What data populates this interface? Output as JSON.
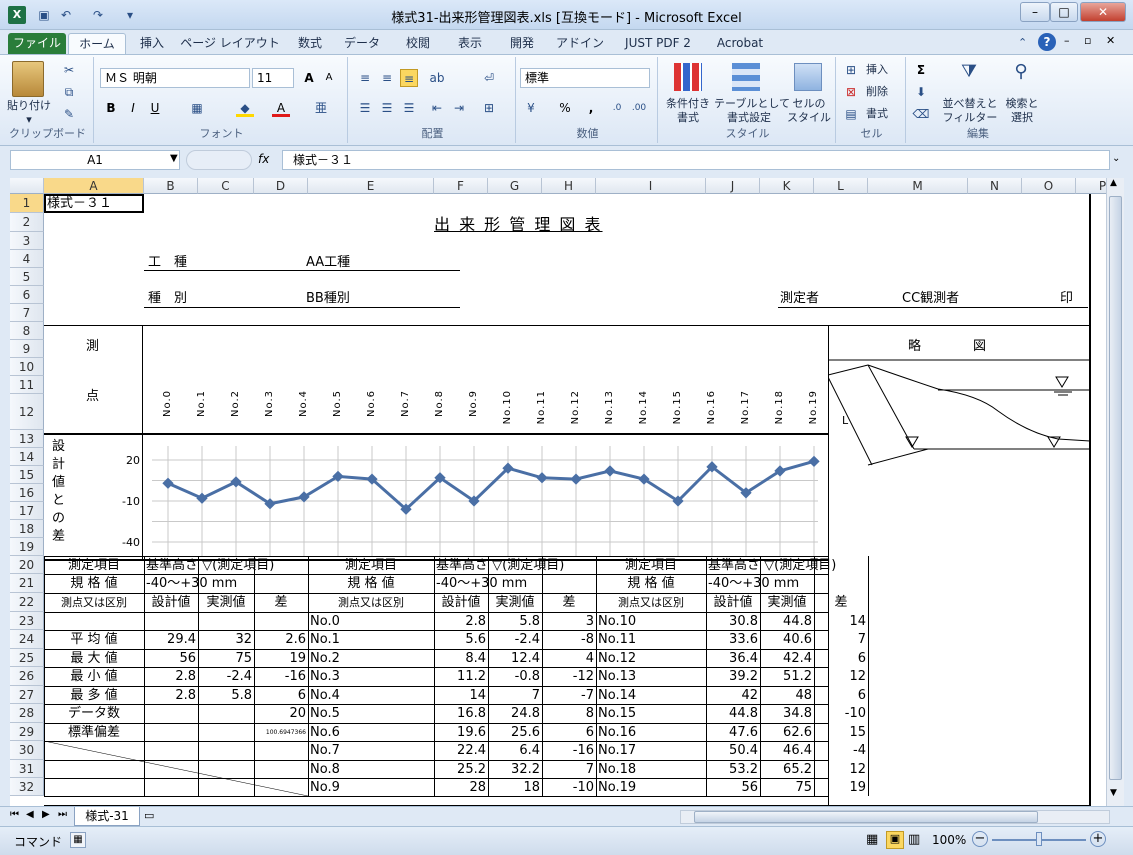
{
  "window": {
    "title": "様式31-出来形管理図表.xls  [互換モード] - Microsoft Excel"
  },
  "ribbon_tabs": [
    "ファイル",
    "ホーム",
    "挿入",
    "ページ レイアウト",
    "数式",
    "データ",
    "校閲",
    "表示",
    "開発",
    "アドイン",
    "JUST PDF 2",
    "Acrobat"
  ],
  "clipboard": {
    "paste": "貼り付け",
    "group": "クリップボード"
  },
  "font": {
    "name": "ＭＳ 明朝",
    "size": "11",
    "bold": "B",
    "italic": "I",
    "underline": "U",
    "group": "フォント",
    "grow": "A",
    "shrink": "A",
    "color_a": "A"
  },
  "alignment": {
    "group": "配置"
  },
  "number": {
    "format": "標準",
    "percent": "%",
    "comma": ",",
    "group": "数値"
  },
  "styles": {
    "conditional": "条件付き\n書式",
    "table": "テーブルとして\n書式設定",
    "cell": "セルの\nスタイル",
    "group": "スタイル"
  },
  "cells_group": {
    "insert": "挿入",
    "delete": "削除",
    "format": "書式",
    "group": "セル"
  },
  "editing": {
    "sum": "Σ",
    "sort": "並べ替えと\nフィルター",
    "find": "検索と\n選択",
    "group": "編集"
  },
  "formula_bar": {
    "name_box": "A1",
    "fx": "fx",
    "value": "様式－３１"
  },
  "columns": [
    "A",
    "B",
    "C",
    "D",
    "E",
    "F",
    "G",
    "H",
    "I",
    "J",
    "K",
    "L",
    "M",
    "N",
    "O",
    "P"
  ],
  "rows": [
    "1",
    "2",
    "3",
    "4",
    "5",
    "6",
    "7",
    "8",
    "9",
    "10",
    "11",
    "12",
    "13",
    "14",
    "15",
    "16",
    "17",
    "18",
    "19",
    "20",
    "21",
    "22",
    "23",
    "24",
    "25",
    "26",
    "27",
    "28",
    "29",
    "30",
    "31",
    "32"
  ],
  "sheet": {
    "a1": "様式－３１",
    "title": "出 来 形 管 理 図 表",
    "koushu_label": "工　種",
    "koushu_value": "AA工種",
    "shubetsu_label": "種　別",
    "shubetsu_value": "BB種別",
    "sokuteisha_label": "測定者",
    "sokuteisha_value": "CC観測者",
    "in": "印",
    "sokuten_1": "測",
    "sokuten_2": "点",
    "ryakuzu": "略　　　　図",
    "diagram_L": "L",
    "vlabel": [
      "設",
      "計",
      "値",
      "と",
      "の",
      "差"
    ],
    "points": [
      "No.0",
      "No.1",
      "No.2",
      "No.3",
      "No.4",
      "No.5",
      "No.6",
      "No.7",
      "No.8",
      "No.9",
      "No.10",
      "No.11",
      "No.12",
      "No.13",
      "No.14",
      "No.15",
      "No.16",
      "No.17",
      "No.18",
      "No.19"
    ],
    "item_label": "測定項目",
    "item_value": "基準高さ ▽(測定項目)",
    "kikaku_label": "規 格 値",
    "kikaku_value": "-40～+30 mm",
    "hdr_point": "測点又は区別",
    "hdr_design": "設計値",
    "hdr_actual": "実測値",
    "hdr_diff": "差",
    "stats": [
      {
        "label": "平 均 値",
        "design": "29.4",
        "actual": "32",
        "diff": "2.6"
      },
      {
        "label": "最 大 値",
        "design": "56",
        "actual": "75",
        "diff": "19"
      },
      {
        "label": "最 小 値",
        "design": "2.8",
        "actual": "-2.4",
        "diff": "-16"
      },
      {
        "label": "最 多 値",
        "design": "2.8",
        "actual": "5.8",
        "diff": "6"
      },
      {
        "label": "データ数",
        "design": "",
        "actual": "",
        "diff": "20"
      },
      {
        "label": "標準偏差",
        "design": "",
        "actual": "",
        "diff": "100.6947366"
      }
    ],
    "table_mid": [
      {
        "p": "No.0",
        "d": "2.8",
        "a": "5.8",
        "x": "3"
      },
      {
        "p": "No.1",
        "d": "5.6",
        "a": "-2.4",
        "x": "-8"
      },
      {
        "p": "No.2",
        "d": "8.4",
        "a": "12.4",
        "x": "4"
      },
      {
        "p": "No.3",
        "d": "11.2",
        "a": "-0.8",
        "x": "-12"
      },
      {
        "p": "No.4",
        "d": "14",
        "a": "7",
        "x": "-7"
      },
      {
        "p": "No.5",
        "d": "16.8",
        "a": "24.8",
        "x": "8"
      },
      {
        "p": "No.6",
        "d": "19.6",
        "a": "25.6",
        "x": "6"
      },
      {
        "p": "No.7",
        "d": "22.4",
        "a": "6.4",
        "x": "-16"
      },
      {
        "p": "No.8",
        "d": "25.2",
        "a": "32.2",
        "x": "7"
      },
      {
        "p": "No.9",
        "d": "28",
        "a": "18",
        "x": "-10"
      }
    ],
    "table_right": [
      {
        "p": "No.10",
        "d": "30.8",
        "a": "44.8",
        "x": "14"
      },
      {
        "p": "No.11",
        "d": "33.6",
        "a": "40.6",
        "x": "7"
      },
      {
        "p": "No.12",
        "d": "36.4",
        "a": "42.4",
        "x": "6"
      },
      {
        "p": "No.13",
        "d": "39.2",
        "a": "51.2",
        "x": "12"
      },
      {
        "p": "No.14",
        "d": "42",
        "a": "48",
        "x": "6"
      },
      {
        "p": "No.15",
        "d": "44.8",
        "a": "34.8",
        "x": "-10"
      },
      {
        "p": "No.16",
        "d": "47.6",
        "a": "62.6",
        "x": "15"
      },
      {
        "p": "No.17",
        "d": "50.4",
        "a": "46.4",
        "x": "-4"
      },
      {
        "p": "No.18",
        "d": "53.2",
        "a": "65.2",
        "x": "12"
      },
      {
        "p": "No.19",
        "d": "56",
        "a": "75",
        "x": "19"
      }
    ]
  },
  "chart_data": {
    "type": "line",
    "x": [
      "No.0",
      "No.1",
      "No.2",
      "No.3",
      "No.4",
      "No.5",
      "No.6",
      "No.7",
      "No.8",
      "No.9",
      "No.10",
      "No.11",
      "No.12",
      "No.13",
      "No.14",
      "No.15",
      "No.16",
      "No.17",
      "No.18",
      "No.19"
    ],
    "series": [
      {
        "values": [
          3,
          -8,
          4,
          -12,
          -7,
          8,
          6,
          -16,
          7,
          -10,
          14,
          7,
          6,
          12,
          6,
          -10,
          15,
          -4,
          12,
          19
        ]
      }
    ],
    "yticks": [
      "20",
      "-10",
      "-40"
    ],
    "ylim": [
      -40,
      30
    ],
    "color": "#4a6fa5"
  },
  "sheet_tab": "様式-31",
  "status": {
    "mode": "コマンド",
    "zoom": "100%"
  }
}
